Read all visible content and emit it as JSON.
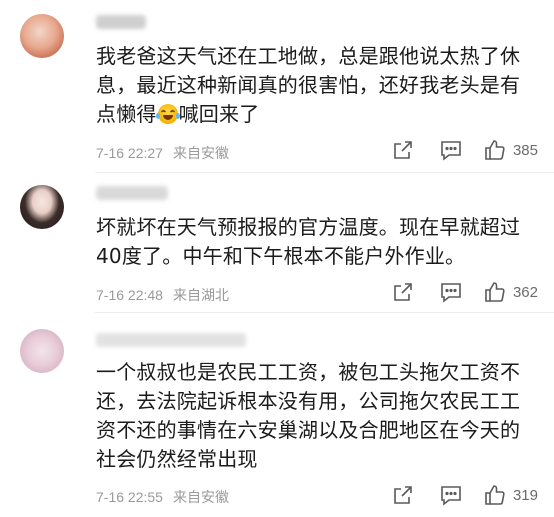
{
  "comments": [
    {
      "username": "██ ██",
      "text_lines": [
        "我老爸这天气还在工地做，总是跟他说太热了休",
        "息，最近这种新闻真的很害怕，还好我老头是有",
        "点懒得",
        "喊回来了"
      ],
      "emoji": "laughing-tears-emoji",
      "date": "7-16 22:27",
      "location": "来自安徽",
      "likes": "385"
    },
    {
      "username": "██ ██",
      "text_lines": [
        "坏就坏在天气预报报的官方温度。现在早就超过",
        "40度了。中午和下午根本不能户外作业。"
      ],
      "date": "7-16 22:48",
      "location": "来自湖北",
      "likes": "362"
    },
    {
      "username": "██ ██",
      "text_lines": [
        "一个叔叔也是农民工工资，被包工头拖欠工资不",
        "还，去法院起诉根本没有用，公司拖欠农民工工",
        "资不还的事情在六安巢湖以及合肥地区在今天的",
        "社会仍然经常出现"
      ],
      "date": "7-16 22:55",
      "location": "来自安徽",
      "likes": "319"
    }
  ],
  "icons": [
    "share-icon",
    "reply-icon",
    "like-icon"
  ],
  "colors": {
    "text": "#1b1b1b",
    "meta": "#9a9a9a",
    "icon": "#5a5a5a",
    "divider": "#ececec"
  }
}
